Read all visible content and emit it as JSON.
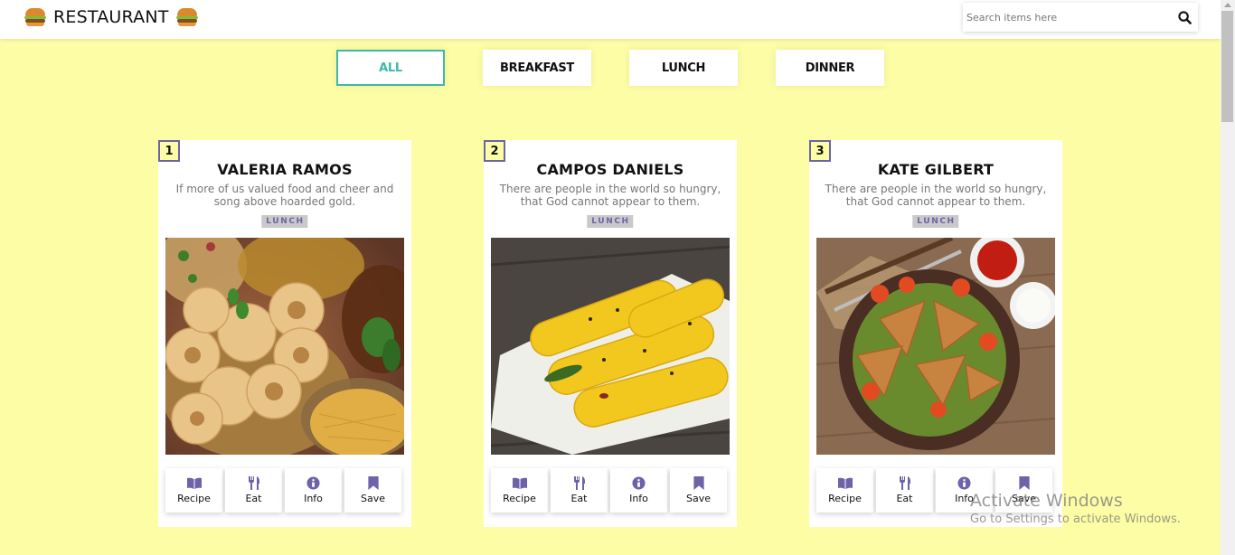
{
  "header": {
    "brand": "RESTAURANT",
    "brand_icon": "hamburger-emoji",
    "search": {
      "placeholder": "Search items here",
      "value": "",
      "icon": "search-icon"
    }
  },
  "filters": [
    {
      "label": "ALL",
      "active": true
    },
    {
      "label": "BREAKFAST",
      "active": false
    },
    {
      "label": "LUNCH",
      "active": false
    },
    {
      "label": "DINNER",
      "active": false
    }
  ],
  "cards": [
    {
      "number": "1",
      "title": "VALERIA RAMOS",
      "description": "If more of us valued food and cheer and song above hoarded gold.",
      "tag": "LUNCH",
      "image": "pani-puri-photo"
    },
    {
      "number": "2",
      "title": "CAMPOS DANIELS",
      "description": "There are people in the world so hungry, that God cannot appear to them.",
      "tag": "LUNCH",
      "image": "khandvi-photo"
    },
    {
      "number": "3",
      "title": "KATE GILBERT",
      "description": "There are people in the world so hungry, that God cannot appear to them.",
      "tag": "LUNCH",
      "image": "samosa-photo"
    }
  ],
  "card_actions": [
    {
      "label": "Recipe",
      "icon": "book-open-icon"
    },
    {
      "label": "Eat",
      "icon": "utensils-icon"
    },
    {
      "label": "Info",
      "icon": "info-circle-icon"
    },
    {
      "label": "Save",
      "icon": "bookmark-icon"
    }
  ],
  "colors": {
    "background": "#fdfda6",
    "accent": "#3fb8a9",
    "icon": "#6d63a8",
    "tag_bg": "#c9c9c9"
  },
  "watermark": {
    "title": "Activate Windows",
    "subtitle": "Go to Settings to activate Windows."
  }
}
